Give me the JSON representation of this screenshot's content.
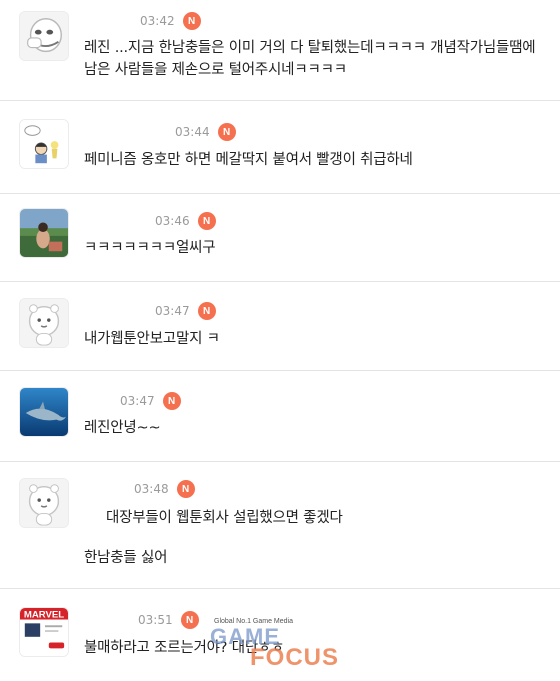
{
  "new_badge": "N",
  "comments": [
    {
      "time": "03:42",
      "lines": [
        "레진 ...지금 한남충들은 이미 거의 다 탈퇴했는데ㅋㅋㅋㅋ 개념작가님들땜에",
        "남은 사람들을 제손으로 털어주시네ㅋㅋㅋㅋ"
      ],
      "avatar": "default-face-avatar"
    },
    {
      "time": "03:44",
      "lines": [
        "페미니즘 옹호만 하면 메갈딱지 붙여서 빨갱이 취급하네"
      ],
      "avatar": "cartoon-avatar"
    },
    {
      "time": "03:46",
      "lines": [
        "ㅋㅋㅋㅋㅋㅋㅋ얼씨구"
      ],
      "avatar": "photo-avatar"
    },
    {
      "time": "03:47",
      "lines": [
        "내가웹툰안보고말지 ㅋ"
      ],
      "avatar": "default-face-avatar"
    },
    {
      "time": "03:47",
      "lines": [
        "레진안녕~~"
      ],
      "avatar": "dolphin-photo-avatar"
    },
    {
      "time": "03:48",
      "lines": [
        "대장부들이 웹툰회사 설립했으면 좋겠다",
        "",
        "한남충들 싫어"
      ],
      "avatar": "default-face-avatar"
    },
    {
      "time": "03:51",
      "lines": [
        "불매하라고 조르는거야? 대단ㅎㅎ"
      ],
      "avatar": "marvel-avatar"
    }
  ],
  "watermark": {
    "tagline": "Global No.1 Game Media",
    "word1": "GAME",
    "word2": "FOCUS"
  },
  "colors": {
    "badge": "#f4704f",
    "time": "#9a9a9a",
    "divider": "#e4e4e4"
  },
  "marvel_logo_text": "MARVEL"
}
